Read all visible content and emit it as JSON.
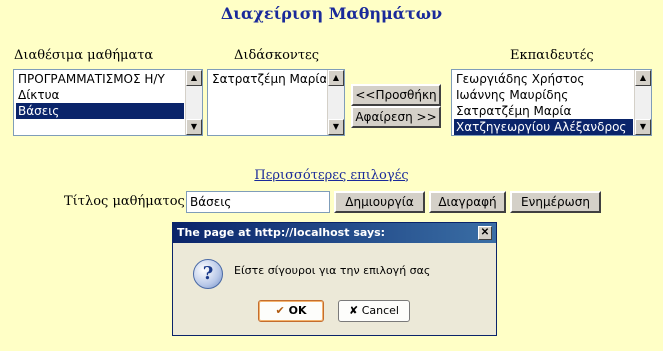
{
  "page_title": "Διαχείριση Μαθημάτων",
  "labels": {
    "available_courses": "Διαθέσιμα μαθήματα",
    "teachers": "Διδάσκοντες",
    "instructors": "Εκπαιδευτές",
    "course_title": "Τίτλος μαθήματος"
  },
  "available_courses": [
    {
      "label": "ΠΡΟΓΡΑΜΜΑΤΙΣΜΟΣ Η/Υ",
      "selected": false
    },
    {
      "label": "Δίκτυα",
      "selected": false
    },
    {
      "label": "Βάσεις",
      "selected": true
    }
  ],
  "teachers": [
    {
      "label": "Σατρατζέμη Μαρία",
      "selected": false
    }
  ],
  "instructors": [
    {
      "label": "Γεωργιάδης Χρήστος",
      "selected": false
    },
    {
      "label": "Ιωάννης Μαυρίδης",
      "selected": false
    },
    {
      "label": "Σατρατζέμη Μαρία",
      "selected": false
    },
    {
      "label": "Χατζηγεωργίου Αλέξανδρος",
      "selected": true
    }
  ],
  "buttons": {
    "add": "<<Προσθήκη",
    "remove": "Αφαίρεση >>",
    "create": "Δημιουργία",
    "delete": "Διαγραφή",
    "update": "Ενημέρωση"
  },
  "more_options_link": "Περισσότερες επιλογές",
  "course_title_value": "Βάσεις",
  "dialog": {
    "title": "The page at http://localhost says:",
    "message": "Είστε σίγουροι για την επιλογή σας",
    "ok_label": "OK",
    "cancel_label": "Cancel"
  },
  "colors": {
    "background": "#ffffc6",
    "title": "#1a2a9a",
    "selection": "#0a246a"
  }
}
